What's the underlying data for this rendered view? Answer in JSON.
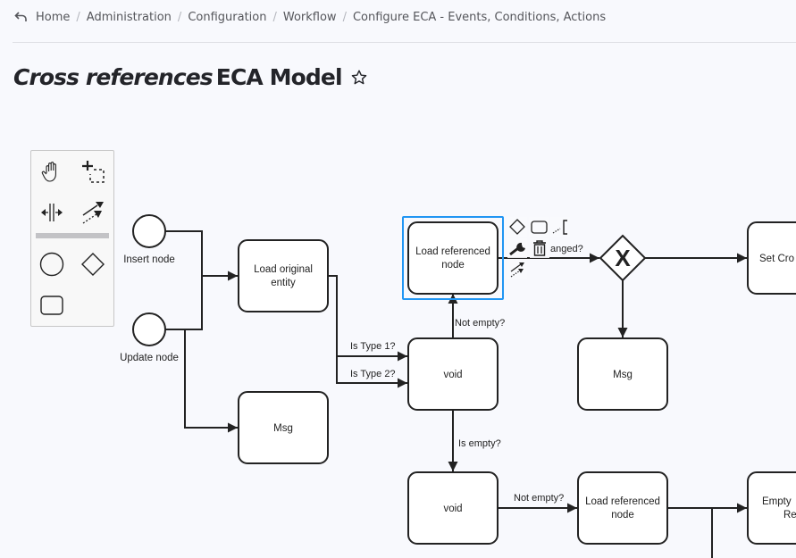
{
  "breadcrumb": {
    "back_icon": "back-arrow-icon",
    "items": [
      "Home",
      "Administration",
      "Configuration",
      "Workflow",
      "Configure ECA - Events, Conditions, Actions"
    ],
    "separator": "/"
  },
  "page": {
    "title_emphasis": "Cross references",
    "title_rest": "ECA Model",
    "favorite_icon": "star-outline-icon"
  },
  "palette": {
    "tools": [
      {
        "name": "hand-tool",
        "icon": "hand-icon"
      },
      {
        "name": "lasso-tool",
        "icon": "lasso-icon"
      },
      {
        "name": "space-tool",
        "icon": "space-tool-icon"
      },
      {
        "name": "global-connect-tool",
        "icon": "connect-icon"
      },
      {
        "name": "create-start-event",
        "icon": "circle-icon"
      },
      {
        "name": "create-gateway",
        "icon": "diamond-icon"
      },
      {
        "name": "create-task",
        "icon": "rounded-rect-icon"
      }
    ]
  },
  "diagram": {
    "events": [
      {
        "id": "insert-node",
        "label": "Insert node"
      },
      {
        "id": "update-node",
        "label": "Update node"
      }
    ],
    "tasks": [
      {
        "id": "load-original-entity",
        "label": [
          "Load original",
          "entity"
        ]
      },
      {
        "id": "msg-1",
        "label": [
          "Msg"
        ]
      },
      {
        "id": "load-referenced-node-1",
        "label": [
          "Load referenced",
          "node"
        ],
        "selected": true
      },
      {
        "id": "void-1",
        "label": [
          "void"
        ]
      },
      {
        "id": "msg-2",
        "label": [
          "Msg"
        ]
      },
      {
        "id": "set-cross",
        "label": [
          "Set Cro"
        ]
      },
      {
        "id": "void-2",
        "label": [
          "void"
        ]
      },
      {
        "id": "load-referenced-node-2",
        "label": [
          "Load referenced",
          "node"
        ]
      },
      {
        "id": "empty-re",
        "label": [
          "Empty",
          "Re"
        ]
      }
    ],
    "gateway": {
      "id": "exclusive-gateway",
      "marker": "X"
    },
    "edge_labels": {
      "is_type_1": "Is Type 1?",
      "is_type_2": "Is Type 2?",
      "not_empty_up": "Not empty?",
      "is_empty": "Is empty?",
      "changed": "anged?",
      "not_empty_right": "Not empty?"
    },
    "selection_color": "#2196f3"
  },
  "context_pad": {
    "entries": [
      {
        "name": "append-gateway",
        "icon": "diamond-icon"
      },
      {
        "name": "append-task",
        "icon": "rounded-rect-icon"
      },
      {
        "name": "append-text-annotation",
        "icon": "text-annotation-icon"
      },
      {
        "name": "change-type",
        "icon": "wrench-icon"
      },
      {
        "name": "delete",
        "icon": "trash-icon"
      },
      {
        "name": "connect",
        "icon": "connect-icon"
      }
    ]
  }
}
